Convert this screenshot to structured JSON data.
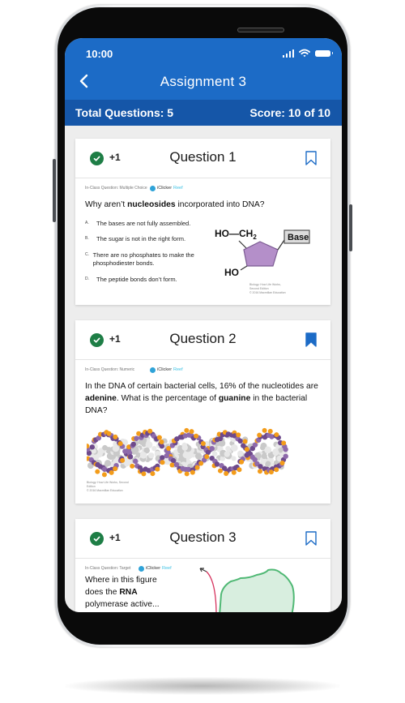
{
  "status_bar": {
    "time": "10:00",
    "icons": [
      "cellular-signal-icon",
      "wifi-icon",
      "battery-icon"
    ]
  },
  "header": {
    "back_icon": "chevron-left-icon",
    "title": "Assignment 3"
  },
  "summary": {
    "total_questions": "Total Questions: 5",
    "score": "Score: 10 of 10"
  },
  "colors": {
    "header_blue": "#1c6bc6",
    "summary_blue": "#1556a8",
    "correct_green": "#1e7e46",
    "bookmark_blue": "#1c6bc6"
  },
  "questions": [
    {
      "title": "Question 1",
      "points": "+1",
      "status": "correct",
      "bookmarked": false,
      "type_label": "In-Class Question: Multiple Choice",
      "brand": {
        "name": "iClicker",
        "suffix": "Reef"
      },
      "prompt": {
        "pre": "Why aren’t ",
        "bold": "nucleosides",
        "post": " incorporated into DNA?"
      },
      "options": [
        {
          "letter": "A.",
          "text": "The bases are not fully assembled."
        },
        {
          "letter": "B.",
          "text": "The sugar is not in the right form."
        },
        {
          "letter": "C.",
          "text": "There are no phosphates to make the phosphodiester bonds."
        },
        {
          "letter": "D.",
          "text": "The peptide bonds don’t form."
        }
      ],
      "figure": {
        "label_top": "HO—CH",
        "subscript": "2",
        "label_bottom": "HO",
        "box_label": "Base"
      },
      "credit": [
        "Biology: How Life Works, Second Edition",
        "© 2016 Macmillan Education"
      ]
    },
    {
      "title": "Question 2",
      "points": "+1",
      "status": "correct",
      "bookmarked": true,
      "type_label": "In-Class Question: Numeric",
      "brand": {
        "name": "iClicker",
        "suffix": "Reef"
      },
      "prompt": {
        "pre": "In the DNA of certain bacterial cells, 16% of the nucleotides are ",
        "bold1": "adenine",
        "mid": ". What is the percentage of ",
        "bold2": "guanine",
        "post": " in the bacterial DNA?"
      },
      "credit": [
        "Biology: How Life Works, Second Edition",
        "© 2016 Macmillan Education"
      ]
    },
    {
      "title": "Question 3",
      "points": "+1",
      "status": "correct",
      "bookmarked": false,
      "type_label": "In-Class Question: Target",
      "brand": {
        "name": "iClicker",
        "suffix": "Reef"
      },
      "prompt": {
        "pre": "Where in this figure does the ",
        "bold": "RNA",
        "post": " polymerase active..."
      }
    }
  ]
}
